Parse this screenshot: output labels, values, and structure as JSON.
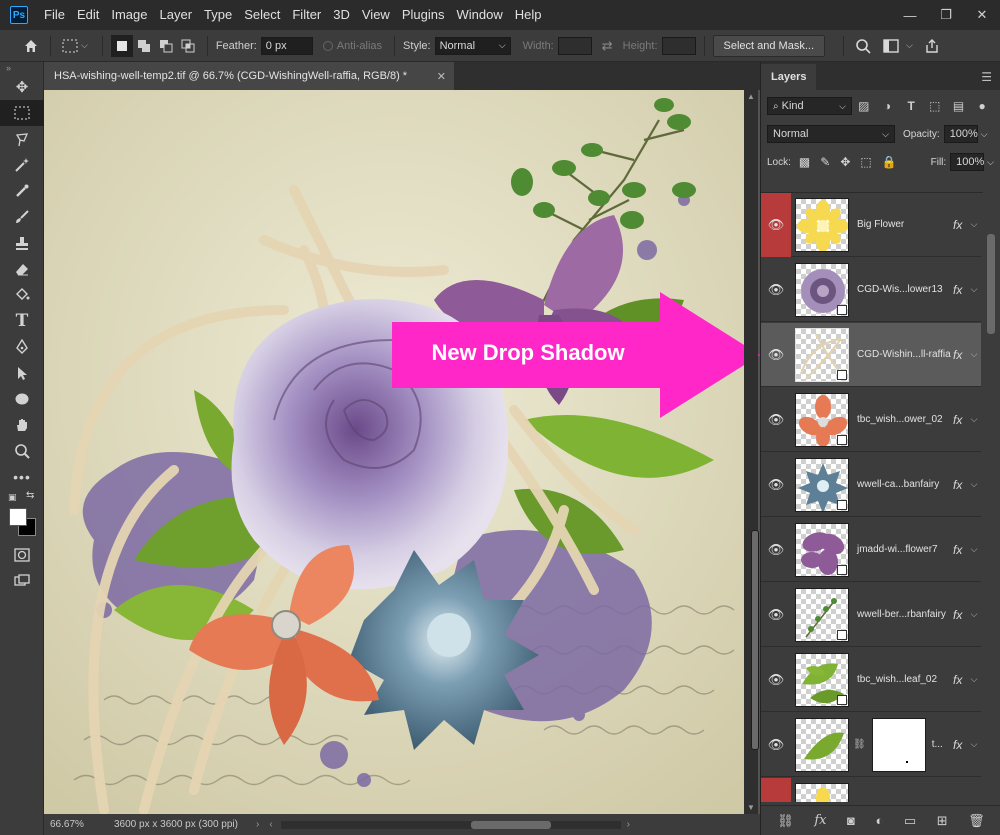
{
  "app": {
    "logo_text": "Ps"
  },
  "menu": [
    "File",
    "Edit",
    "Image",
    "Layer",
    "Type",
    "Select",
    "Filter",
    "3D",
    "View",
    "Plugins",
    "Window",
    "Help"
  ],
  "window_controls": {
    "minimize": "—",
    "restore": "❐",
    "close": "✕"
  },
  "options": {
    "feather_label": "Feather:",
    "feather_value": "0 px",
    "antialias_label": "Anti-alias",
    "style_label": "Style:",
    "style_value": "Normal",
    "width_label": "Width:",
    "height_label": "Height:",
    "select_mask_label": "Select and Mask..."
  },
  "document": {
    "tab_title": "HSA-wishing-well-temp2.tif @ 66.7% (CGD-WishingWell-raffia, RGB/8) *",
    "zoom": "66.67%",
    "dimensions": "3600 px x 3600 px (300 ppi)"
  },
  "layers_panel": {
    "title": "Layers",
    "filter_kind": "Kind",
    "blend_mode": "Normal",
    "opacity_label": "Opacity:",
    "opacity_value": "100%",
    "lock_label": "Lock:",
    "fill_label": "Fill:",
    "fill_value": "100%",
    "fx_label": "fx",
    "layers": [
      {
        "name": "Big Flower",
        "eye_red": true,
        "selected": false
      },
      {
        "name": "CGD-Wis...lower13",
        "eye_red": false,
        "selected": false
      },
      {
        "name": "CGD-Wishin...ll-raffia",
        "eye_red": false,
        "selected": true
      },
      {
        "name": "tbc_wish...ower_02",
        "eye_red": false,
        "selected": false
      },
      {
        "name": "wwell-ca...banfairy",
        "eye_red": false,
        "selected": false
      },
      {
        "name": "jmadd-wi...flower7",
        "eye_red": false,
        "selected": false
      },
      {
        "name": "wwell-ber...rbanfairy",
        "eye_red": false,
        "selected": false
      },
      {
        "name": "tbc_wish...leaf_02",
        "eye_red": false,
        "selected": false
      },
      {
        "name": "t...",
        "eye_red": false,
        "selected": false
      }
    ]
  },
  "callout": {
    "text": "New Drop Shadow",
    "color": "#ff27c8"
  },
  "colors": {
    "menu_bg": "#2b2b2b",
    "panel_bg": "#3c3c3c",
    "accent_red": "#b83b3b"
  }
}
